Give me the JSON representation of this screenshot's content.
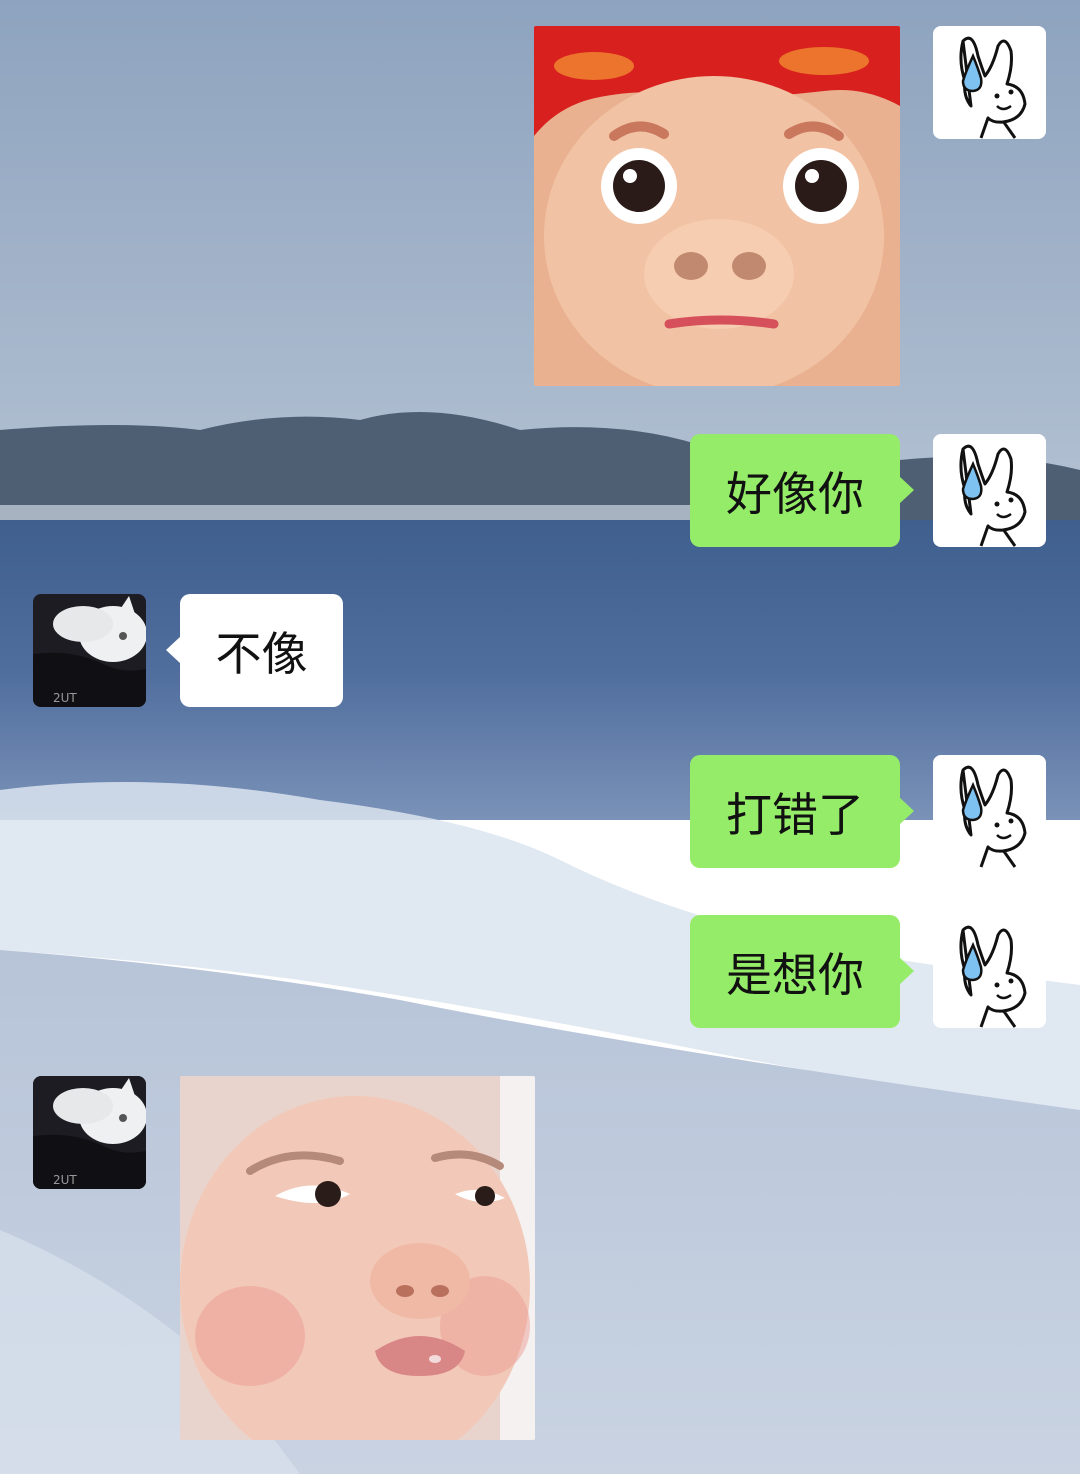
{
  "chat": {
    "messages": [
      {
        "side": "right",
        "type": "sticker",
        "sticker": "pig-face-sticker"
      },
      {
        "side": "right",
        "type": "text",
        "text": "好像你"
      },
      {
        "side": "left",
        "type": "text",
        "text": "不像"
      },
      {
        "side": "right",
        "type": "text",
        "text": "打错了"
      },
      {
        "side": "right",
        "type": "text",
        "text": "是想你"
      },
      {
        "side": "left",
        "type": "sticker",
        "sticker": "pouting-baby-sticker"
      }
    ]
  },
  "avatars": {
    "self": "bunny-sweat-icon",
    "other": "white-cat-photo"
  },
  "colors": {
    "mine_bubble": "#95ec69",
    "theirs_bubble": "#ffffff"
  }
}
